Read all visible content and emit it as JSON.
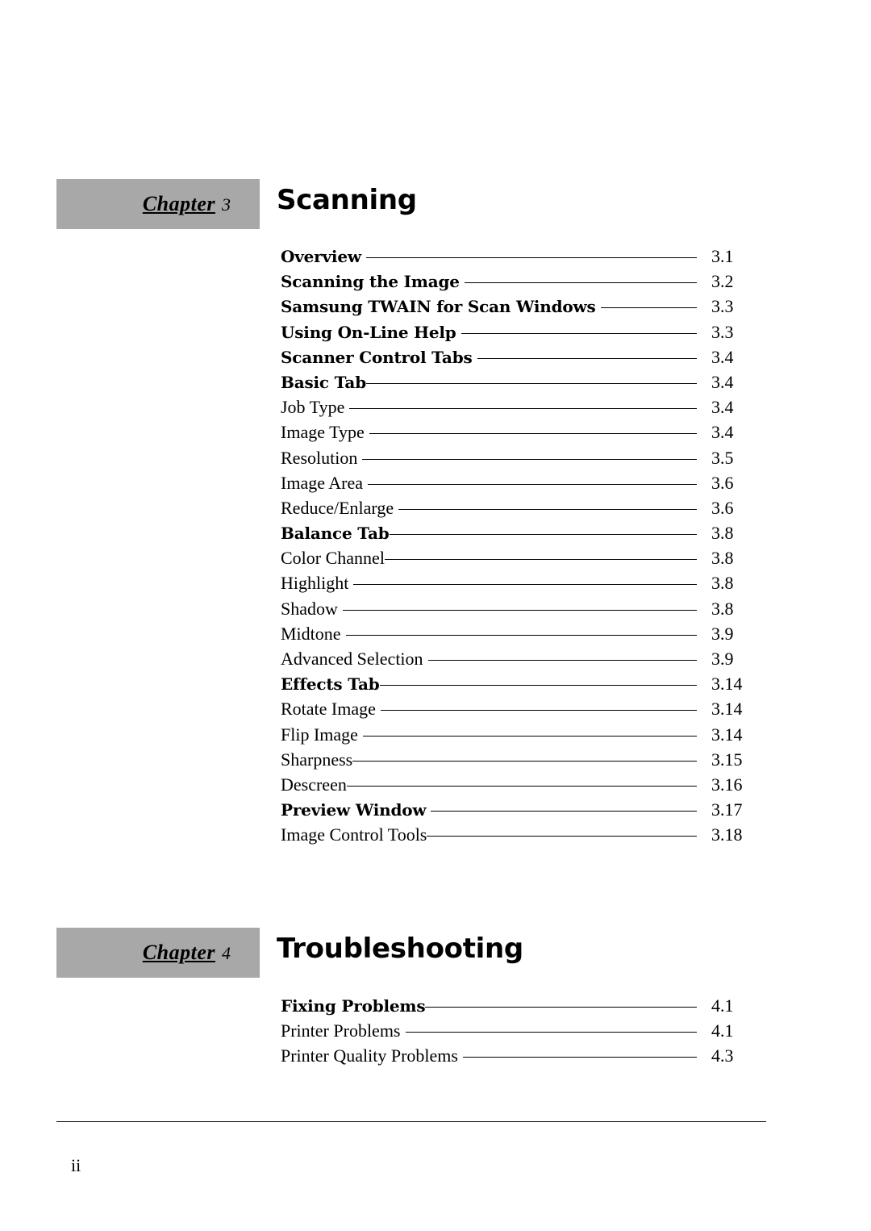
{
  "page": {
    "folio": "ii"
  },
  "chapters": [
    {
      "tag_word": "Chapter",
      "tag_number": "3",
      "title": "Scanning",
      "entries": [
        {
          "label": "Overview",
          "page": "3.1",
          "bold": true
        },
        {
          "label": "Scanning the Image",
          "page": "3.2",
          "bold": true
        },
        {
          "label": "Samsung TWAIN for Scan Windows",
          "page": "3.3",
          "bold": true
        },
        {
          "label": "Using On-Line Help",
          "page": "3.3",
          "bold": true
        },
        {
          "label": "Scanner  Control Tabs",
          "page": "3.4",
          "bold": true
        },
        {
          "label": "Basic Tab",
          "page": "3.4",
          "bold": true
        },
        {
          "label": "Job Type",
          "page": "3.4",
          "bold": false
        },
        {
          "label": "Image Type",
          "page": "3.4",
          "bold": false
        },
        {
          "label": "Resolution",
          "page": "3.5",
          "bold": false
        },
        {
          "label": "Image Area",
          "page": "3.6",
          "bold": false
        },
        {
          "label": "Reduce/Enlarge",
          "page": "3.6",
          "bold": false
        },
        {
          "label": "Balance Tab",
          "page": "3.8",
          "bold": true
        },
        {
          "label": "Color Channel",
          "page": "3.8",
          "bold": false
        },
        {
          "label": "Highlight",
          "page": "3.8",
          "bold": false
        },
        {
          "label": "Shadow",
          "page": "3.8",
          "bold": false
        },
        {
          "label": "Midtone",
          "page": "3.9",
          "bold": false
        },
        {
          "label": "Advanced Selection",
          "page": "3.9",
          "bold": false
        },
        {
          "label": "Effects Tab",
          "page": "3.14",
          "bold": true
        },
        {
          "label": "Rotate Image",
          "page": "3.14",
          "bold": false
        },
        {
          "label": "Flip Image",
          "page": "3.14",
          "bold": false
        },
        {
          "label": "Sharpness",
          "page": "3.15",
          "bold": false
        },
        {
          "label": "Descreen",
          "page": "3.16",
          "bold": false
        },
        {
          "label": "Preview Window",
          "page": "3.17",
          "bold": true
        },
        {
          "label": "Image Control Tools",
          "page": "3.18",
          "bold": false
        }
      ]
    },
    {
      "tag_word": "Chapter",
      "tag_number": "4",
      "title": "Troubleshooting",
      "entries": [
        {
          "label": "Fixing Problems",
          "page": "4.1",
          "bold": true
        },
        {
          "label": "Printer Problems",
          "page": "4.1",
          "bold": false
        },
        {
          "label": "Printer Quality Problems",
          "page": "4.3",
          "bold": false
        }
      ]
    }
  ]
}
